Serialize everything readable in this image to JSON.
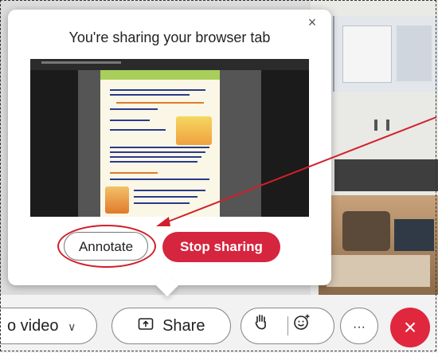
{
  "popover": {
    "title": "You're sharing your browser tab",
    "close_label": "×",
    "annotate_label": "Annotate",
    "stop_label": "Stop sharing"
  },
  "controls": {
    "video_label": "o video",
    "video_chevron": "∨",
    "share_label": "Share",
    "more_label": "···",
    "end_label": "×"
  },
  "colors": {
    "accent_red": "#d6253f",
    "annotation_red": "#d21f2a"
  },
  "icons": [
    "close-icon",
    "share-screen-icon",
    "raise-hand-icon",
    "emoji-reaction-icon",
    "more-icon",
    "end-call-icon",
    "chevron-down-icon"
  ]
}
